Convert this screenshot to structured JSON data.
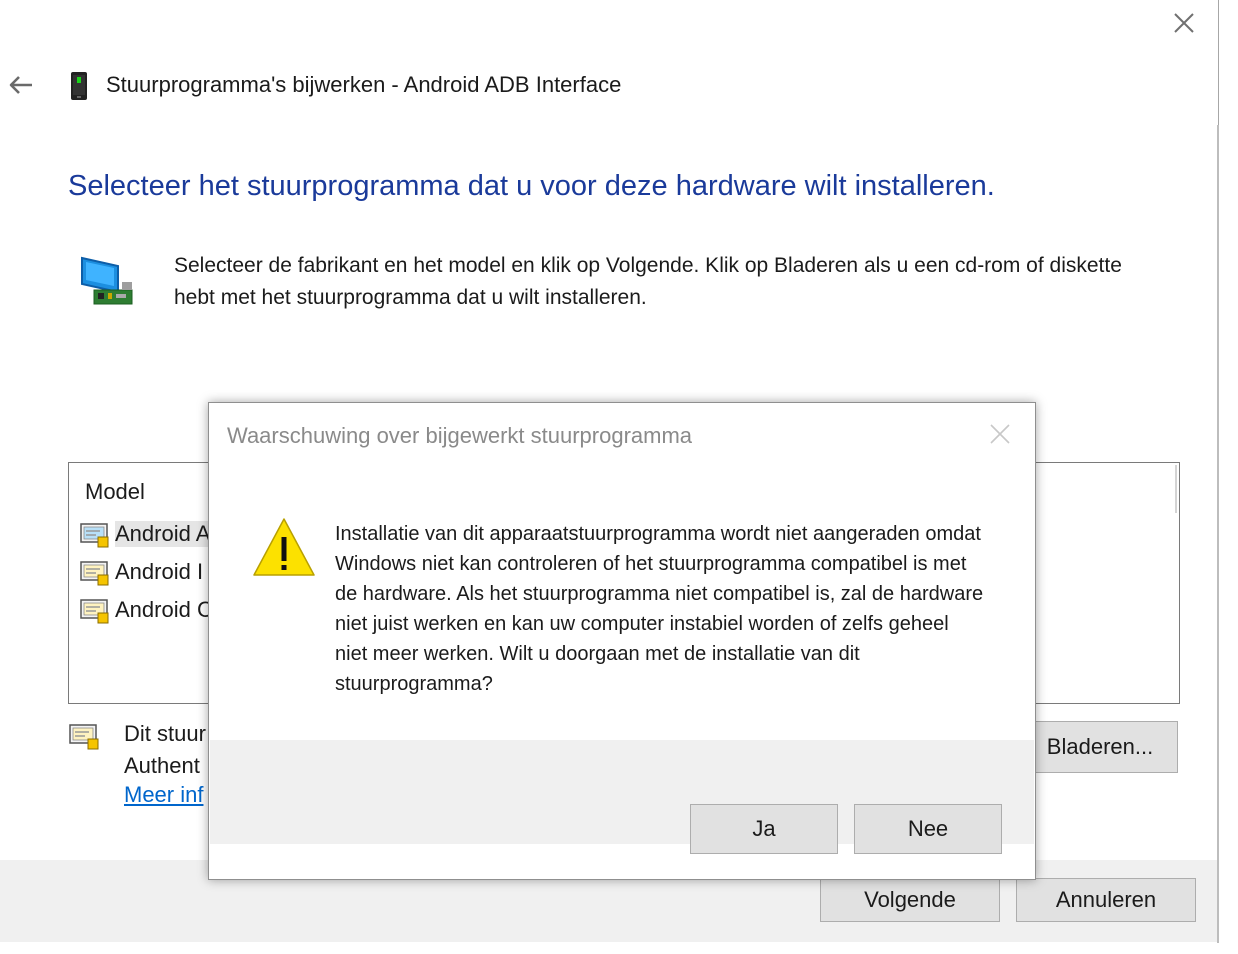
{
  "window": {
    "title": "Stuurprogramma's bijwerken - Android ADB Interface",
    "close_icon": "close-icon",
    "back_icon": "back-arrow-icon",
    "device_icon": "phone-icon"
  },
  "page": {
    "heading": "Selecteer het stuurprogramma dat u voor deze hardware wilt installeren.",
    "instructions": "Selecteer de fabrikant en het model en klik op Volgende. Klik op Bladeren als u een cd-rom of diskette hebt met het stuurprogramma dat u wilt installeren.",
    "hardware_icon": "monitor-hardware-icon"
  },
  "model_list": {
    "header": "Model",
    "items": [
      {
        "label": "Android A",
        "selected": true
      },
      {
        "label": "Android I",
        "selected": false
      },
      {
        "label": "Android C",
        "selected": false
      }
    ],
    "item_icon": "driver-certificate-icon"
  },
  "signature": {
    "line1": "Dit stuur",
    "line2": "Authent",
    "link": "Meer inf"
  },
  "buttons": {
    "browse": "Bladeren...",
    "next": "Volgende",
    "cancel": "Annuleren"
  },
  "dialog": {
    "title": "Waarschuwing over bijgewerkt stuurprogramma",
    "message": "Installatie van dit apparaatstuurprogramma wordt niet aangeraden omdat Windows niet kan controleren of het stuurprogramma compatibel is met de hardware.  Als het stuurprogramma niet compatibel is, zal de hardware niet juist werken en kan uw computer instabiel worden of zelfs geheel niet meer werken.  Wilt u doorgaan met de installatie van dit stuurprogramma?",
    "icon": "warning-icon",
    "yes": "Ja",
    "no": "Nee"
  },
  "colors": {
    "heading": "#1a3a9a",
    "link": "#0066cc",
    "button_face": "#e1e1e1",
    "footer": "#f0f0f0",
    "warning": "#fce100"
  }
}
